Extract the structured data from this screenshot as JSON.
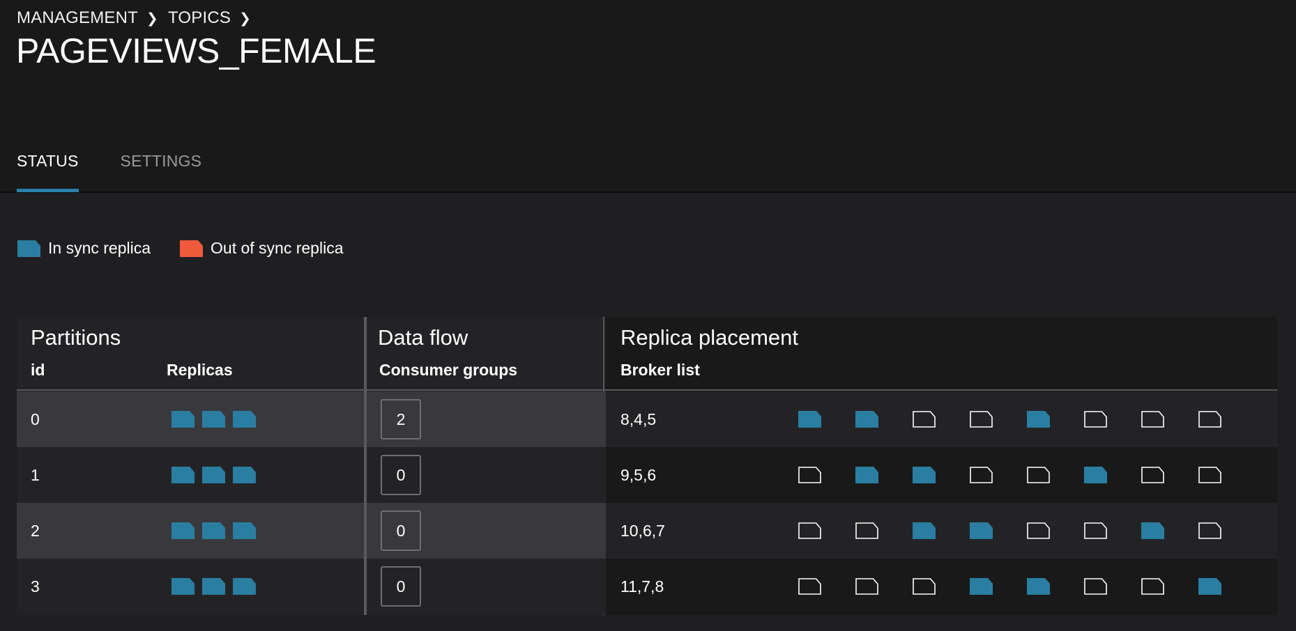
{
  "breadcrumb": [
    "MANAGEMENT",
    "TOPICS"
  ],
  "page_title": "PAGEVIEWS_FEMALE",
  "tabs": [
    {
      "label": "STATUS",
      "active": true
    },
    {
      "label": "SETTINGS",
      "active": false
    }
  ],
  "legend": [
    {
      "label": "In sync replica",
      "color": "#2a7ea1"
    },
    {
      "label": "Out of sync replica",
      "color": "#f05a3c"
    }
  ],
  "sections": {
    "partitions": {
      "title": "Partitions",
      "col_id": "id",
      "col_replicas": "Replicas"
    },
    "dataflow": {
      "title": "Data flow",
      "col_consumer": "Consumer groups"
    },
    "replica": {
      "title": "Replica placement",
      "col_broker": "Broker list"
    }
  },
  "colors": {
    "in_sync": "#2a7ea1",
    "out_of_sync": "#f05a3c",
    "empty_outline": "#ffffff"
  },
  "rows": [
    {
      "id": "0",
      "replicas": [
        "in_sync",
        "in_sync",
        "in_sync"
      ],
      "consumer_groups": "2",
      "broker_list": "8,4,5",
      "placement": [
        1,
        1,
        0,
        0,
        1,
        0,
        0,
        0
      ]
    },
    {
      "id": "1",
      "replicas": [
        "in_sync",
        "in_sync",
        "in_sync"
      ],
      "consumer_groups": "0",
      "broker_list": "9,5,6",
      "placement": [
        0,
        1,
        1,
        0,
        0,
        1,
        0,
        0
      ]
    },
    {
      "id": "2",
      "replicas": [
        "in_sync",
        "in_sync",
        "in_sync"
      ],
      "consumer_groups": "0",
      "broker_list": "10,6,7",
      "placement": [
        0,
        0,
        1,
        1,
        0,
        0,
        1,
        0
      ]
    },
    {
      "id": "3",
      "replicas": [
        "in_sync",
        "in_sync",
        "in_sync"
      ],
      "consumer_groups": "0",
      "broker_list": "11,7,8",
      "placement": [
        0,
        0,
        0,
        1,
        1,
        0,
        0,
        1
      ]
    }
  ]
}
